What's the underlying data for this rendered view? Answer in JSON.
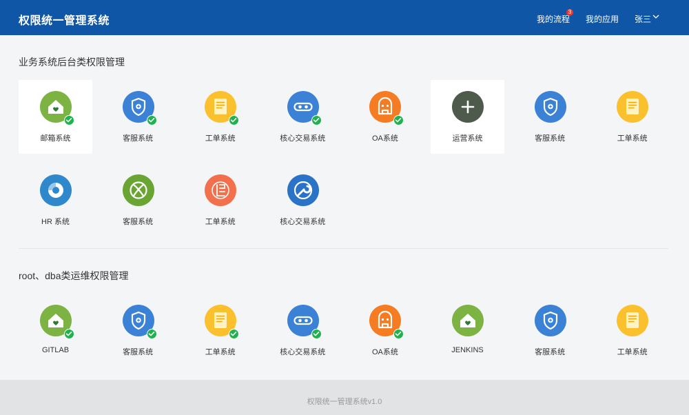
{
  "header": {
    "app_title": "权限统一管理系统",
    "my_flow": "我的流程",
    "my_flow_count": "3",
    "my_apps": "我的应用",
    "user_name": "张三"
  },
  "sections": [
    {
      "title": "业务系统后台类权限管理",
      "items": [
        {
          "label": "邮箱系统",
          "icon": "house-heart-icon",
          "color": "#7cb342",
          "checked": true,
          "active": true
        },
        {
          "label": "客服系统",
          "icon": "shield-icon",
          "color": "#3b82d6",
          "checked": true,
          "active": false
        },
        {
          "label": "工单系统",
          "icon": "document-icon",
          "color": "#fbc02d",
          "checked": true,
          "active": false
        },
        {
          "label": "核心交易系统",
          "icon": "link-icon",
          "color": "#3b82d6",
          "checked": true,
          "active": false
        },
        {
          "label": "OA系统",
          "icon": "robot-icon",
          "color": "#f57c22",
          "checked": true,
          "active": false
        },
        {
          "label": "运营系统",
          "icon": "plus-icon",
          "color": "#4e5a4b",
          "checked": false,
          "active": true
        },
        {
          "label": "客服系统",
          "icon": "shield-icon",
          "color": "#3b82d6",
          "checked": false,
          "active": false
        },
        {
          "label": "工单系统",
          "icon": "document-icon",
          "color": "#fbc02d",
          "checked": false,
          "active": false
        },
        {
          "label": "HR 系统",
          "icon": "donut-icon",
          "color": "#2f88cc",
          "checked": false,
          "active": false
        },
        {
          "label": "客服系统",
          "icon": "xbox-icon",
          "color": "#6aa534",
          "checked": false,
          "active": false
        },
        {
          "label": "工单系统",
          "icon": "circuit-icon",
          "color": "#f2704b",
          "checked": false,
          "active": false
        },
        {
          "label": "核心交易系统",
          "icon": "wrench-icon",
          "color": "#2a73c6",
          "checked": false,
          "active": false
        }
      ]
    },
    {
      "title": "root、dba类运维权限管理",
      "items": [
        {
          "label": "GITLAB",
          "icon": "house-heart-icon",
          "color": "#7cb342",
          "checked": true,
          "active": false
        },
        {
          "label": "客服系统",
          "icon": "shield-icon",
          "color": "#3b82d6",
          "checked": true,
          "active": false
        },
        {
          "label": "工单系统",
          "icon": "document-icon",
          "color": "#fbc02d",
          "checked": true,
          "active": false
        },
        {
          "label": "核心交易系统",
          "icon": "link-icon",
          "color": "#3b82d6",
          "checked": true,
          "active": false
        },
        {
          "label": "OA系统",
          "icon": "robot-icon",
          "color": "#f57c22",
          "checked": true,
          "active": false
        },
        {
          "label": "JENKINS",
          "icon": "house-heart-icon",
          "color": "#7cb342",
          "checked": false,
          "active": false
        },
        {
          "label": "客服系统",
          "icon": "shield-icon",
          "color": "#3b82d6",
          "checked": false,
          "active": false
        },
        {
          "label": "工单系统",
          "icon": "document-icon",
          "color": "#fbc02d",
          "checked": false,
          "active": false
        }
      ]
    }
  ],
  "footer": {
    "text": "权限统一管理系统v1.0"
  }
}
